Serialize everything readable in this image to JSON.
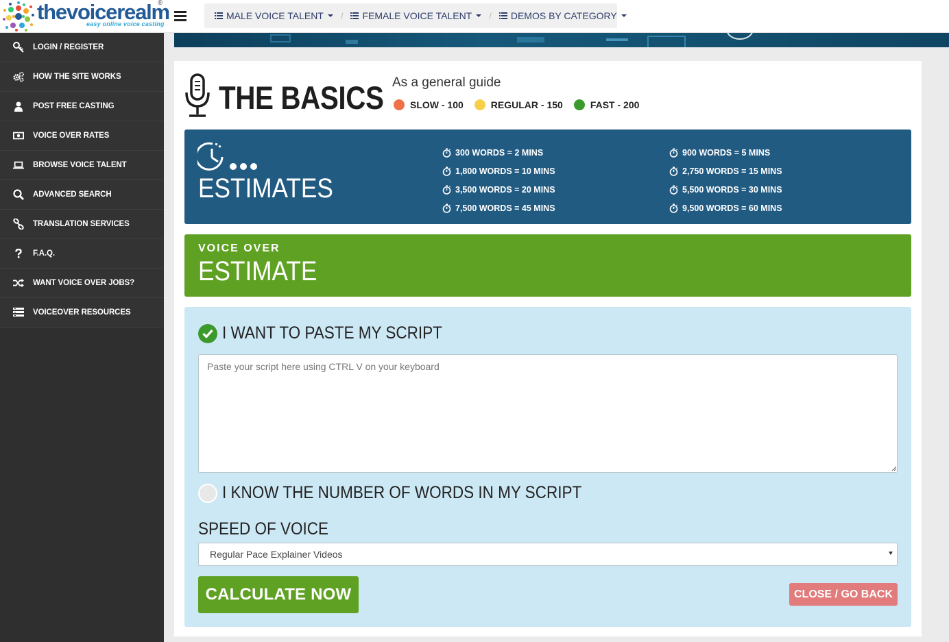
{
  "brand": {
    "name_part1": "the",
    "name_part2": "voice",
    "name_part3": "realm",
    "tagline": "easy online voice casting",
    "registered": "®"
  },
  "topnav": {
    "items": [
      {
        "label": "MALE VOICE TALENT",
        "icon": "list-icon"
      },
      {
        "label": "FEMALE VOICE TALENT",
        "icon": "list-icon"
      },
      {
        "label": "DEMOS BY CATEGORY",
        "icon": "list-icon"
      }
    ],
    "separator": "/"
  },
  "sidebar": {
    "items": [
      {
        "label": "LOGIN / REGISTER",
        "icon": "key-icon"
      },
      {
        "label": "HOW THE SITE WORKS",
        "icon": "gears-icon"
      },
      {
        "label": "POST FREE CASTING",
        "icon": "user-icon"
      },
      {
        "label": "VOICE OVER RATES",
        "icon": "money-icon"
      },
      {
        "label": "BROWSE VOICE TALENT",
        "icon": "laptop-icon"
      },
      {
        "label": "ADVANCED SEARCH",
        "icon": "search-icon"
      },
      {
        "label": "TRANSLATION SERVICES",
        "icon": "link-icon"
      },
      {
        "label": "F.A.Q.",
        "icon": "question-icon"
      },
      {
        "label": "WANT VOICE OVER JOBS?",
        "icon": "shuffle-icon"
      },
      {
        "label": "VOICEOVER RESOURCES",
        "icon": "list-icon"
      }
    ]
  },
  "basics": {
    "title": "THE BASICS",
    "guide": "As a general guide",
    "legend": [
      {
        "label": "SLOW - 100",
        "color": "#f07148"
      },
      {
        "label": "REGULAR - 150",
        "color": "#f7cf4a"
      },
      {
        "label": "FAST - 200",
        "color": "#3b9a2c"
      }
    ]
  },
  "estimates": {
    "title": "ESTIMATES",
    "left": [
      "300 WORDS = 2 MINS",
      "1,800 WORDS = 10 MINS",
      "3,500 WORDS = 20 MINS",
      "7,500 WORDS = 45 MINS"
    ],
    "right": [
      "900 WORDS = 5 MINS",
      "2,750 WORDS = 15 MINS",
      "5,500 WORDS = 30 MINS",
      "9,500 WORDS = 60 MINS"
    ]
  },
  "vo_bar": {
    "small": "VOICE OVER",
    "big": "ESTIMATE"
  },
  "form": {
    "option_paste": "I WANT TO PASTE MY SCRIPT",
    "script_placeholder": "Paste your script here using CTRL V on your keyboard",
    "option_words": "I KNOW THE NUMBER OF WORDS IN MY SCRIPT",
    "speed_label": "SPEED OF VOICE",
    "speed_selected": "Regular Pace Explainer Videos",
    "calculate_label": "CALCULATE NOW",
    "close_label": "CLOSE / GO BACK"
  },
  "colors": {
    "sidebar_bg": "#333333",
    "estimates_bg": "#225b82",
    "green": "#5fa122",
    "form_bg": "#cce8f5",
    "close_btn": "#e27b7b"
  }
}
